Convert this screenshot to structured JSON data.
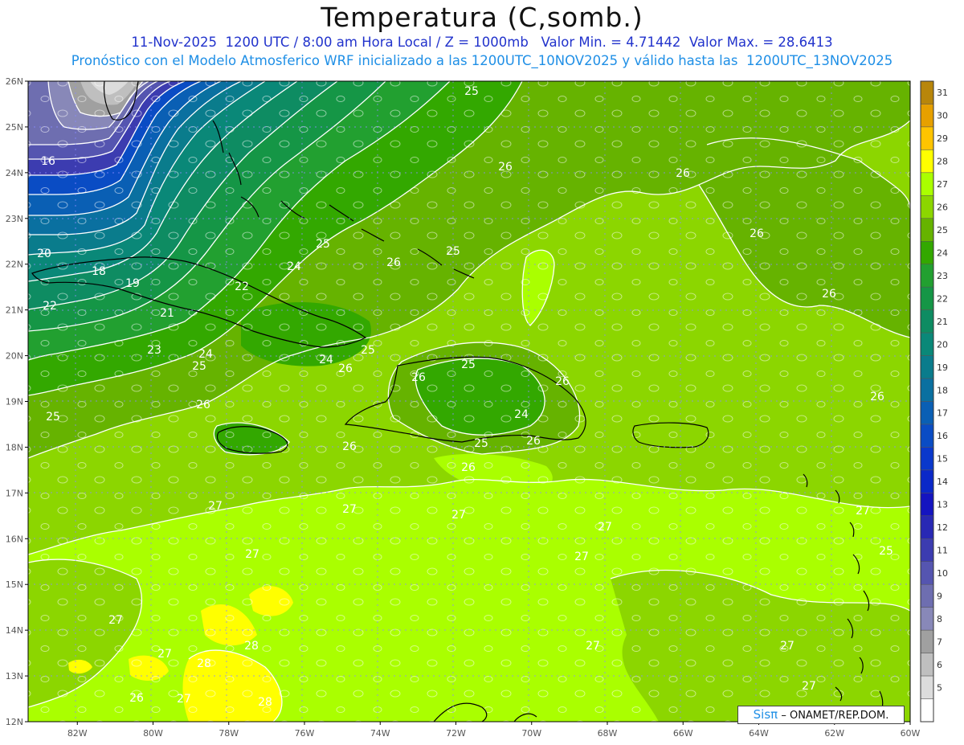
{
  "header": {
    "title": "Temperatura (C,somb.)",
    "line1": "11-Nov-2025  1200 UTC / 8:00 am Hora Local / Z = 1000mb   Valor Min. = 4.71442  Valor Max. = 28.6413",
    "line2": "Pronóstico con el Modelo Atmosferico WRF inicializado a las 1200UTC_10NOV2025 y válido hasta las  1200UTC_13NOV2025"
  },
  "axes": {
    "lon_labels": [
      "82W",
      "80W",
      "78W",
      "76W",
      "74W",
      "72W",
      "70W",
      "68W",
      "66W",
      "64W",
      "62W",
      "60W"
    ],
    "lat_labels": [
      "26N",
      "25N",
      "24N",
      "23N",
      "22N",
      "21N",
      "20N",
      "19N",
      "18N",
      "17N",
      "16N",
      "15N",
      "14N",
      "13N",
      "12N"
    ],
    "lon_range": [
      -83.3,
      -60
    ],
    "lat_range": [
      12,
      26
    ],
    "grid": "dotted"
  },
  "colorbar": {
    "levels": [
      "31",
      "30",
      "29",
      "28",
      "27",
      "26",
      "25",
      "24",
      "23",
      "22",
      "21",
      "20",
      "19",
      "18",
      "17",
      "16",
      "15",
      "14",
      "13",
      "12",
      "11",
      "10",
      "9",
      "8",
      "7",
      "6",
      "5"
    ],
    "colors": [
      "#b8860b",
      "#e6a000",
      "#ffc400",
      "#ffff00",
      "#aaff00",
      "#8cd600",
      "#66b300",
      "#33a800",
      "#22a030",
      "#159646",
      "#0e8c62",
      "#0a8878",
      "#0a7c8c",
      "#0a70a0",
      "#0a5fb4",
      "#0a4cc4",
      "#0a38cc",
      "#0a28c8",
      "#1414c0",
      "#2828b4",
      "#3c3cb0",
      "#5555b0",
      "#6e6eb0",
      "#8888b8",
      "#a0a0a0",
      "#bfbfbf",
      "#dcdcdc"
    ],
    "bottom_color": "#ffffff"
  },
  "contour_labels": [
    {
      "text": "16"
    },
    {
      "text": "20"
    },
    {
      "text": "18"
    },
    {
      "text": "19"
    },
    {
      "text": "22"
    },
    {
      "text": "21"
    },
    {
      "text": "23"
    },
    {
      "text": "24"
    },
    {
      "text": "25"
    },
    {
      "text": "25"
    },
    {
      "text": "26"
    },
    {
      "text": "25"
    },
    {
      "text": "24"
    },
    {
      "text": "22"
    },
    {
      "text": "25"
    },
    {
      "text": "26"
    },
    {
      "text": "25"
    },
    {
      "text": "25"
    },
    {
      "text": "26"
    },
    {
      "text": "24"
    },
    {
      "text": "26"
    },
    {
      "text": "26"
    },
    {
      "text": "26"
    },
    {
      "text": "25"
    },
    {
      "text": "26"
    },
    {
      "text": "24"
    },
    {
      "text": "26"
    },
    {
      "text": "26"
    },
    {
      "text": "26"
    },
    {
      "text": "25"
    },
    {
      "text": "26"
    },
    {
      "text": "26"
    },
    {
      "text": "27"
    },
    {
      "text": "27"
    },
    {
      "text": "27"
    },
    {
      "text": "27"
    },
    {
      "text": "27"
    },
    {
      "text": "27"
    },
    {
      "text": "27"
    },
    {
      "text": "27"
    },
    {
      "text": "28"
    },
    {
      "text": "28"
    },
    {
      "text": "28"
    },
    {
      "text": "27"
    },
    {
      "text": "26"
    },
    {
      "text": "27"
    },
    {
      "text": "27"
    },
    {
      "text": "27"
    },
    {
      "text": "27"
    },
    {
      "text": "25"
    },
    {
      "text": "26"
    }
  ],
  "credit": {
    "logo": "Sisπ",
    "text": "– ONAMET/REP.DOM."
  }
}
